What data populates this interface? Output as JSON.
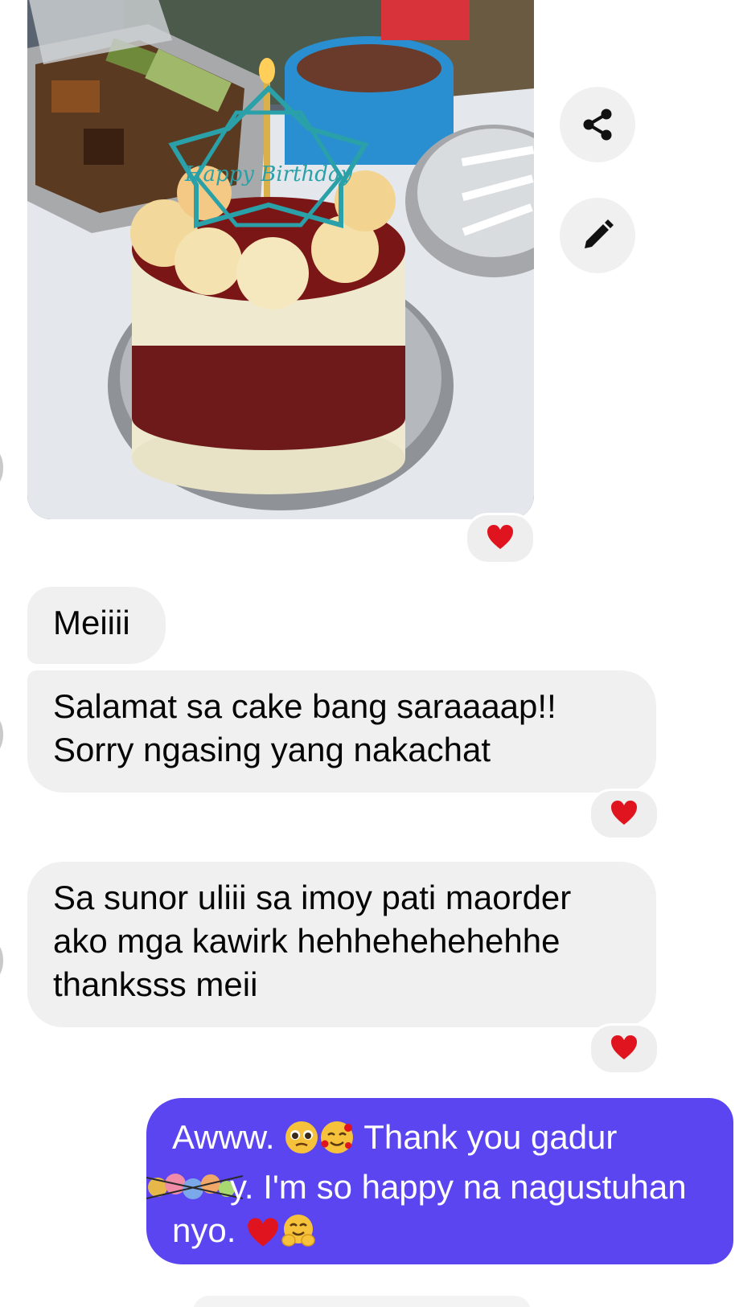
{
  "colors": {
    "incoming_bubble": "#f0f0f0",
    "outgoing_bubble": "#5a45f0",
    "reaction_bg": "#eeeeee",
    "heart": "#e0141e"
  },
  "actions": {
    "share_icon": "share-icon",
    "edit_icon": "pencil-icon"
  },
  "photo": {
    "topper_text": "Happy Birthday"
  },
  "messages": [
    {
      "id": "m1",
      "direction": "incoming",
      "text": "Meiiii"
    },
    {
      "id": "m2",
      "direction": "incoming",
      "text": "Salamat sa cake bang saraaaap!!\nSorry ngasing yang nakachat",
      "reaction": "red-heart"
    },
    {
      "id": "m3",
      "direction": "incoming",
      "text": "Sa sunor uliii sa imoy pati maorder\nako mga kawirk hehhehehehehhe\nthanksss meii",
      "reaction": "red-heart"
    },
    {
      "id": "m4",
      "direction": "outgoing",
      "part1": "Awww. ",
      "part2": " Thank you gadur",
      "part3": "y. I'm so happy na nagustuhan",
      "part4": "nyo. ",
      "emojis": [
        "pleading-face",
        "smiling-face-with-hearts",
        "red-heart",
        "hugging-face"
      ],
      "sticker": "flower-sticker"
    }
  ],
  "photo_reaction": "red-heart"
}
